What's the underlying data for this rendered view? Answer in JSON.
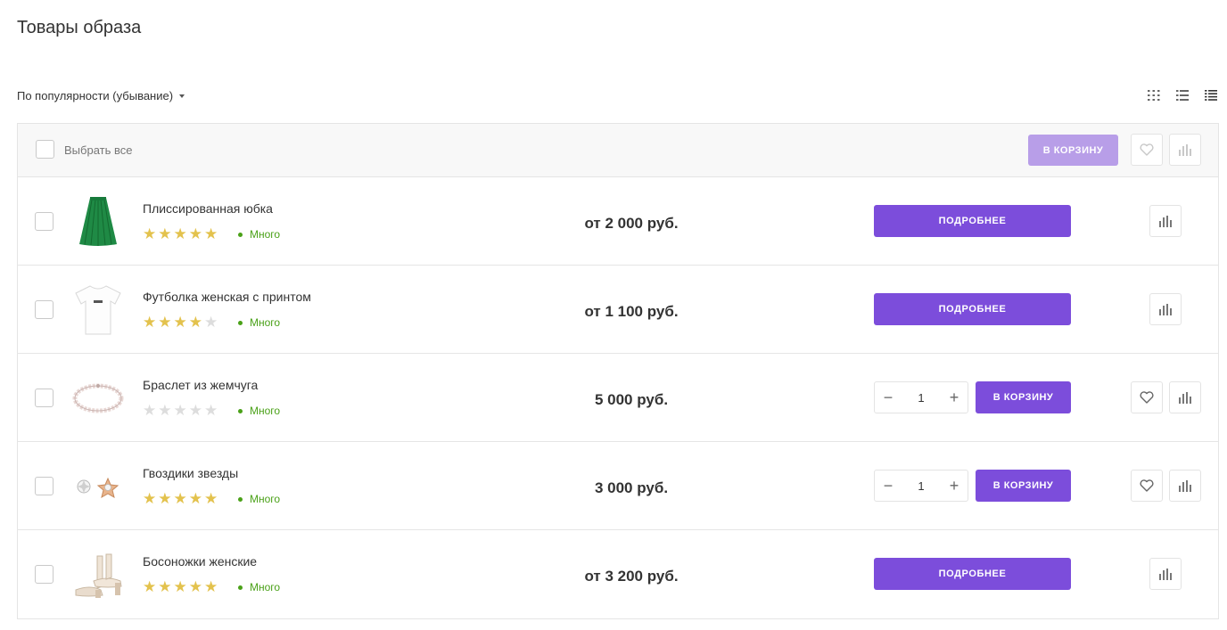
{
  "page_title": "Товары образа",
  "sort": {
    "label": "По популярности (убывание)"
  },
  "views": [
    "grid-view-icon",
    "list-view-icon",
    "table-view-icon"
  ],
  "header": {
    "select_all": "Выбрать все",
    "cart_button": "В КОРЗИНУ"
  },
  "colors": {
    "accent": "#7c4ddb",
    "accent_disabled": "#b89ee8",
    "star": "#e3c24d",
    "star_empty": "#dddddd",
    "stock": "#4aa118"
  },
  "products": [
    {
      "name": "Плиссированная юбка",
      "rating": 5,
      "stock": "Много",
      "price": "от 2 000 руб.",
      "action": "ПОДРОБНЕЕ",
      "type": "more",
      "image": "skirt"
    },
    {
      "name": "Футболка женская с принтом",
      "rating": 4,
      "stock": "Много",
      "price": "от 1 100 руб.",
      "action": "ПОДРОБНЕЕ",
      "type": "more",
      "image": "tshirt"
    },
    {
      "name": "Браслет из жемчуга",
      "rating": 0,
      "stock": "Много",
      "price": "5 000 руб.",
      "action": "В КОРЗИНУ",
      "type": "cart",
      "qty": "1",
      "image": "bracelet"
    },
    {
      "name": "Гвоздики звезды",
      "rating": 5,
      "stock": "Много",
      "price": "3 000 руб.",
      "action": "В КОРЗИНУ",
      "type": "cart",
      "qty": "1",
      "image": "earrings"
    },
    {
      "name": "Босоножки женские",
      "rating": 5,
      "stock": "Много",
      "price": "от 3 200 руб.",
      "action": "ПОДРОБНЕЕ",
      "type": "more",
      "image": "sandals"
    }
  ]
}
